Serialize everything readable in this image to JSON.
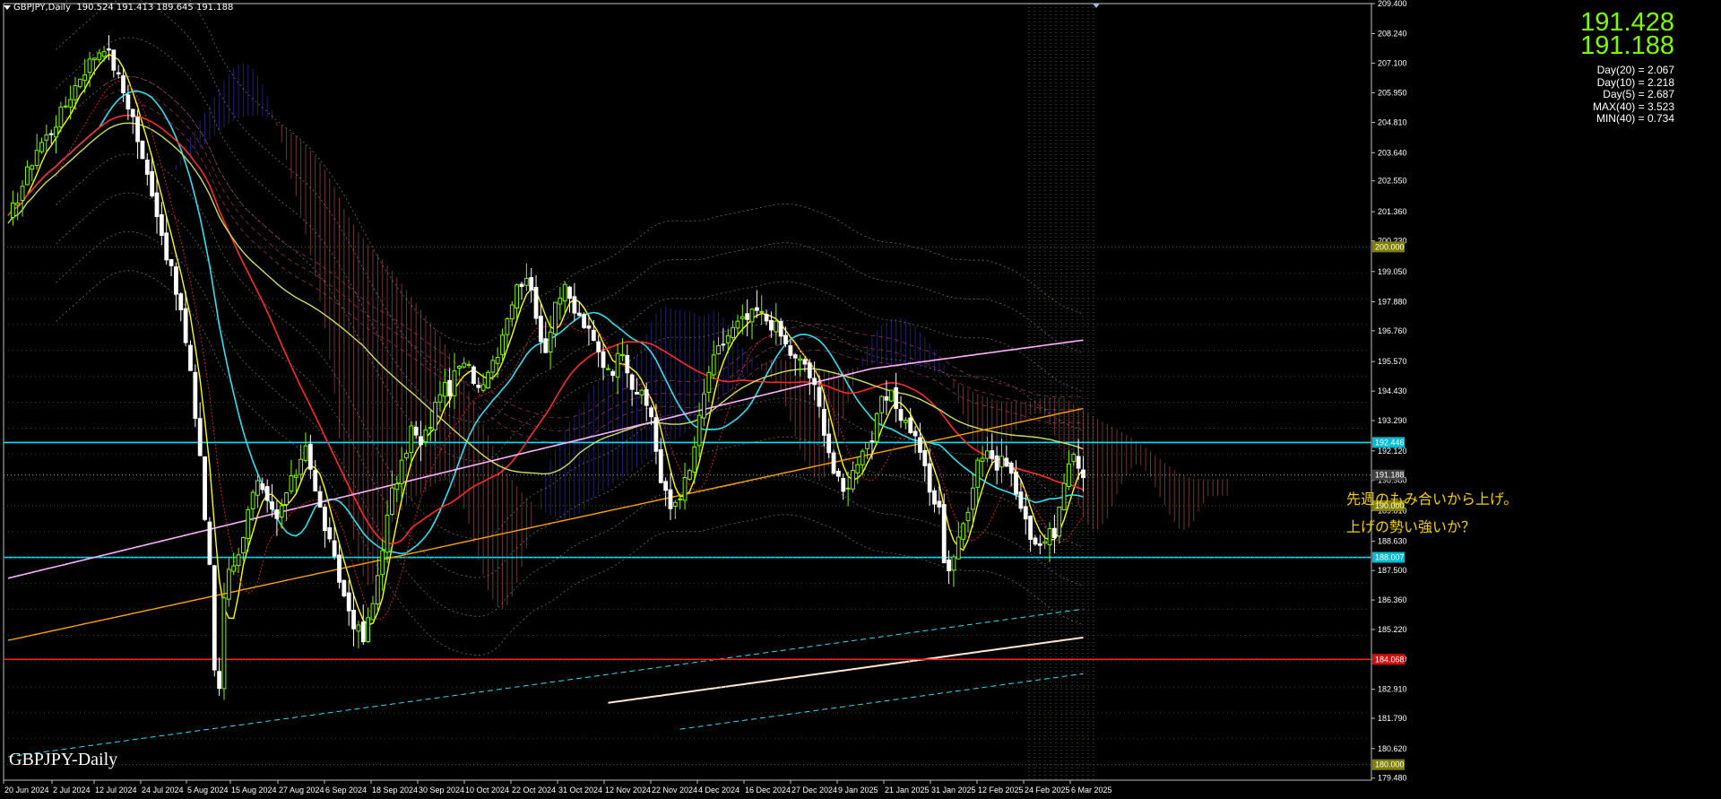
{
  "header": {
    "symbol": "GBPJPY,Daily",
    "ohlc": "190.524 191.413 189.645 191.188"
  },
  "prices": {
    "upper": "191.428",
    "lower": "191.188"
  },
  "stats": [
    "Day(20) = 2.067",
    "Day(10) = 2.218",
    "Day(5) = 2.687",
    "MAX(40) = 3.523",
    "MIN(40) = 0.734"
  ],
  "watermark": "GBPJPY-Daily",
  "annotations": [
    "先週のもみ合いから上げ。",
    "上げの勢い強いか？"
  ],
  "colors": {
    "bull": "#7cfc00",
    "bear": "#ffffff",
    "cyan_level": "#00e5ff",
    "red_level": "#ff2020",
    "ma_yellow": "#ffff00",
    "ma_cyan": "#2ee0f0",
    "ma_red": "#ff2a2a",
    "ma_olive": "#c8e060",
    "ma_pink": "#ffb0ff",
    "ma_orange": "#ffa500",
    "cloud_blue": "#3a3ad0",
    "cloud_red": "#d06060"
  },
  "chart_data": {
    "type": "candlestick",
    "symbol": "GBPJPY",
    "timeframe": "Daily",
    "ylim": [
      179.4,
      209.4
    ],
    "y_ticks": [
      "209.400",
      "208.240",
      "207.100",
      "205.950",
      "204.810",
      "203.640",
      "202.550",
      "201.360",
      "200.230",
      "199.050",
      "197.880",
      "196.760",
      "195.570",
      "194.430",
      "193.290",
      "192.120",
      "190.980",
      "189.810",
      "188.630",
      "187.500",
      "186.360",
      "185.220",
      "184.070",
      "182.910",
      "181.790",
      "180.620",
      "179.480"
    ],
    "x_ticks": [
      "20 Jun 2024",
      "2 Jul 2024",
      "12 Jul 2024",
      "24 Jul 2024",
      "5 Aug 2024",
      "15 Aug 2024",
      "27 Aug 2024",
      "6 Sep 2024",
      "18 Sep 2024",
      "30 Sep 2024",
      "10 Oct 2024",
      "22 Oct 2024",
      "31 Oct 2024",
      "12 Nov 2024",
      "22 Nov 2024",
      "4 Dec 2024",
      "16 Dec 2024",
      "27 Dec 2024",
      "9 Jan 2025",
      "21 Jan 2025",
      "31 Jan 2025",
      "12 Feb 2025",
      "24 Feb 2025",
      "6 Mar 2025"
    ],
    "levels": [
      {
        "label": "200.000",
        "value": 200.0,
        "color": "#555500",
        "style": "dotted"
      },
      {
        "label": "192.446",
        "value": 192.446,
        "color": "#00e5ff",
        "style": "solid"
      },
      {
        "label": "191.188",
        "value": 191.188,
        "color": "#aaaaaa",
        "style": "dotted"
      },
      {
        "label": "190.000",
        "value": 190.0,
        "color": "#555500",
        "style": "dotted"
      },
      {
        "label": "188.007",
        "value": 188.007,
        "color": "#00e5ff",
        "style": "solid"
      },
      {
        "label": "184.068",
        "value": 184.068,
        "color": "#ff2020",
        "style": "solid"
      },
      {
        "label": "180.000",
        "value": 180.0,
        "color": "#555500",
        "style": "dotted"
      }
    ],
    "key_points": [
      [
        0,
        201.0
      ],
      [
        3,
        202.4
      ],
      [
        6,
        203.8
      ],
      [
        9,
        204.5
      ],
      [
        12,
        205.5
      ],
      [
        15,
        206.6
      ],
      [
        18,
        207.4
      ],
      [
        20,
        207.8
      ],
      [
        22,
        207.0
      ],
      [
        24,
        206.0
      ],
      [
        26,
        205.0
      ],
      [
        28,
        203.3
      ],
      [
        30,
        202.2
      ],
      [
        32,
        200.5
      ],
      [
        34,
        199.0
      ],
      [
        36,
        197.5
      ],
      [
        38,
        195.0
      ],
      [
        40,
        192.0
      ],
      [
        41,
        189.5
      ],
      [
        42,
        187.8
      ],
      [
        43,
        183.5
      ],
      [
        44,
        183.0
      ],
      [
        45,
        186.5
      ],
      [
        46,
        187.7
      ],
      [
        48,
        188.0
      ],
      [
        50,
        190.0
      ],
      [
        52,
        190.8
      ],
      [
        54,
        190.0
      ],
      [
        56,
        189.4
      ],
      [
        58,
        190.5
      ],
      [
        60,
        191.3
      ],
      [
        62,
        192.5
      ],
      [
        64,
        190.5
      ],
      [
        66,
        189.2
      ],
      [
        68,
        187.8
      ],
      [
        70,
        186.5
      ],
      [
        72,
        185.5
      ],
      [
        74,
        184.8
      ],
      [
        76,
        186.2
      ],
      [
        78,
        188.5
      ],
      [
        80,
        190.5
      ],
      [
        82,
        191.5
      ],
      [
        84,
        193.0
      ],
      [
        86,
        192.3
      ],
      [
        88,
        193.2
      ],
      [
        90,
        194.5
      ],
      [
        92,
        194.5
      ],
      [
        94,
        195.4
      ],
      [
        96,
        195.3
      ],
      [
        98,
        194.6
      ],
      [
        100,
        195.3
      ],
      [
        102,
        196.0
      ],
      [
        104,
        197.4
      ],
      [
        106,
        198.4
      ],
      [
        108,
        199.0
      ],
      [
        110,
        197.2
      ],
      [
        112,
        196.0
      ],
      [
        114,
        197.9
      ],
      [
        116,
        198.3
      ],
      [
        118,
        197.5
      ],
      [
        120,
        197.0
      ],
      [
        122,
        196.3
      ],
      [
        124,
        195.5
      ],
      [
        126,
        195.3
      ],
      [
        128,
        196.1
      ],
      [
        130,
        194.7
      ],
      [
        132,
        194.2
      ],
      [
        134,
        193.5
      ],
      [
        136,
        190.9
      ],
      [
        138,
        189.9
      ],
      [
        140,
        190.5
      ],
      [
        142,
        191.3
      ],
      [
        144,
        193.3
      ],
      [
        146,
        195.2
      ],
      [
        148,
        196.0
      ],
      [
        150,
        196.6
      ],
      [
        152,
        197.0
      ],
      [
        154,
        197.2
      ],
      [
        156,
        197.5
      ],
      [
        158,
        197.2
      ],
      [
        160,
        196.9
      ],
      [
        162,
        196.2
      ],
      [
        164,
        195.6
      ],
      [
        166,
        195.5
      ],
      [
        168,
        194.5
      ],
      [
        170,
        193.0
      ],
      [
        172,
        191.3
      ],
      [
        174,
        190.5
      ],
      [
        176,
        191.3
      ],
      [
        178,
        192.3
      ],
      [
        180,
        192.6
      ],
      [
        182,
        194.0
      ],
      [
        184,
        194.2
      ],
      [
        186,
        193.5
      ],
      [
        188,
        193.0
      ],
      [
        190,
        192.2
      ],
      [
        192,
        190.5
      ],
      [
        194,
        189.8
      ],
      [
        195,
        188.0
      ],
      [
        196,
        187.6
      ],
      [
        198,
        188.6
      ],
      [
        200,
        190.0
      ],
      [
        202,
        191.8
      ],
      [
        204,
        192.2
      ],
      [
        206,
        191.5
      ],
      [
        208,
        191.8
      ],
      [
        210,
        190.5
      ],
      [
        212,
        189.3
      ],
      [
        214,
        188.6
      ],
      [
        216,
        188.7
      ],
      [
        218,
        189.0
      ],
      [
        220,
        190.7
      ],
      [
        222,
        192.0
      ],
      [
        224,
        191.2
      ]
    ]
  }
}
